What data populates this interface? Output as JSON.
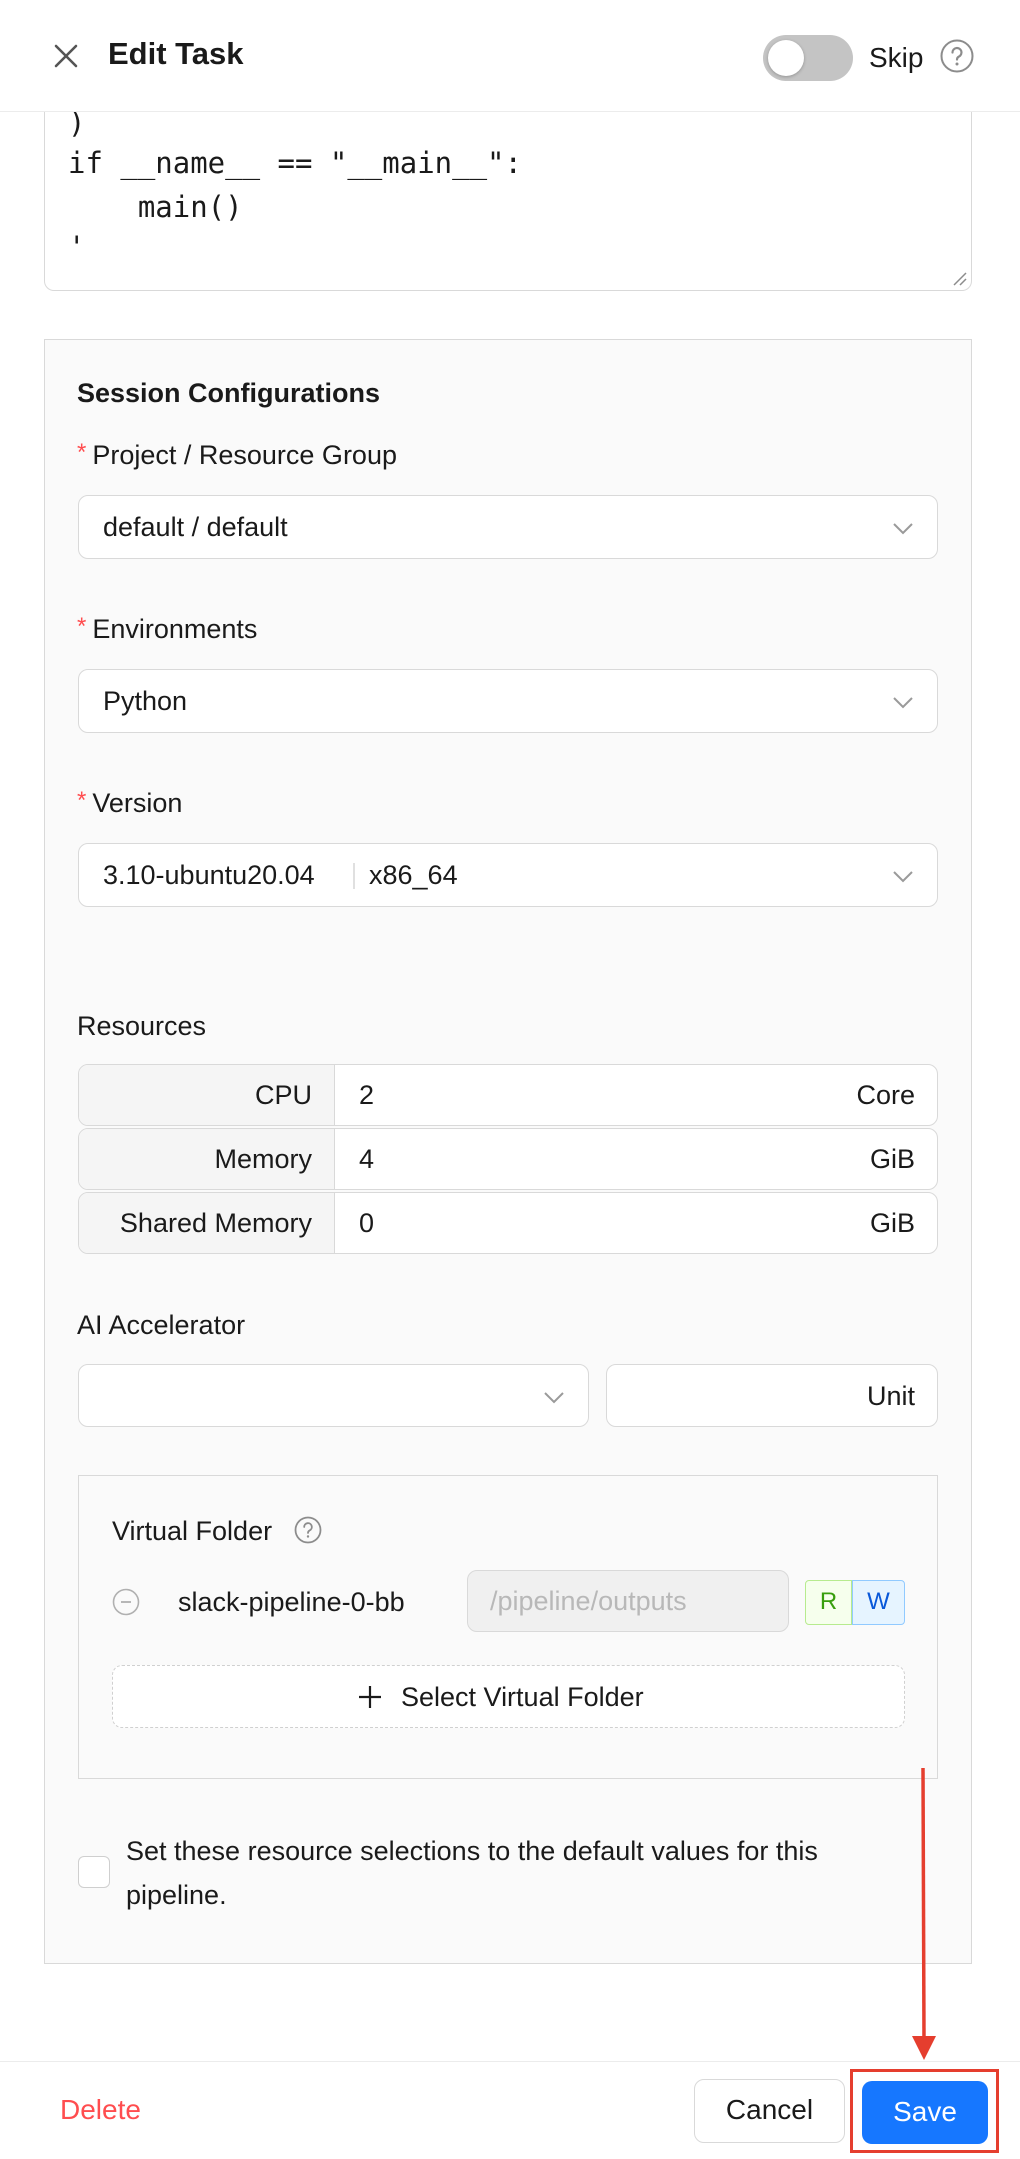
{
  "header": {
    "title": "Edit Task",
    "skip_label": "Skip",
    "skip_enabled": false
  },
  "code": {
    "lines": [
      ")",
      "if __name__ == \"__main__\":",
      "    main()",
      "'"
    ]
  },
  "session": {
    "section_title": "Session Configurations",
    "project": {
      "label": "Project / Resource Group",
      "value": "default / default"
    },
    "environments": {
      "label": "Environments",
      "value": "Python"
    },
    "version": {
      "label": "Version",
      "value": "3.10-ubuntu20.04",
      "arch": "x86_64"
    },
    "resources": {
      "label": "Resources",
      "rows": [
        {
          "name": "CPU",
          "value": "2",
          "unit": "Core"
        },
        {
          "name": "Memory",
          "value": "4",
          "unit": "GiB"
        },
        {
          "name": "Shared Memory",
          "value": "0",
          "unit": "GiB"
        }
      ]
    },
    "accelerator": {
      "label": "AI Accelerator",
      "value": "",
      "unit": "Unit"
    },
    "virtual_folder": {
      "label": "Virtual Folder",
      "folder_name": "slack-pipeline-0-bb",
      "path_placeholder": "/pipeline/outputs",
      "perm_read": "R",
      "perm_write": "W",
      "add_label": "Select Virtual Folder"
    },
    "default_checkbox_label": "Set these resource selections to the default values for this pipeline."
  },
  "footer": {
    "delete_label": "Delete",
    "cancel_label": "Cancel",
    "save_label": "Save"
  },
  "colors": {
    "primary": "#1677ff",
    "danger": "#ff4d4f",
    "highlight": "#e53e2e"
  }
}
